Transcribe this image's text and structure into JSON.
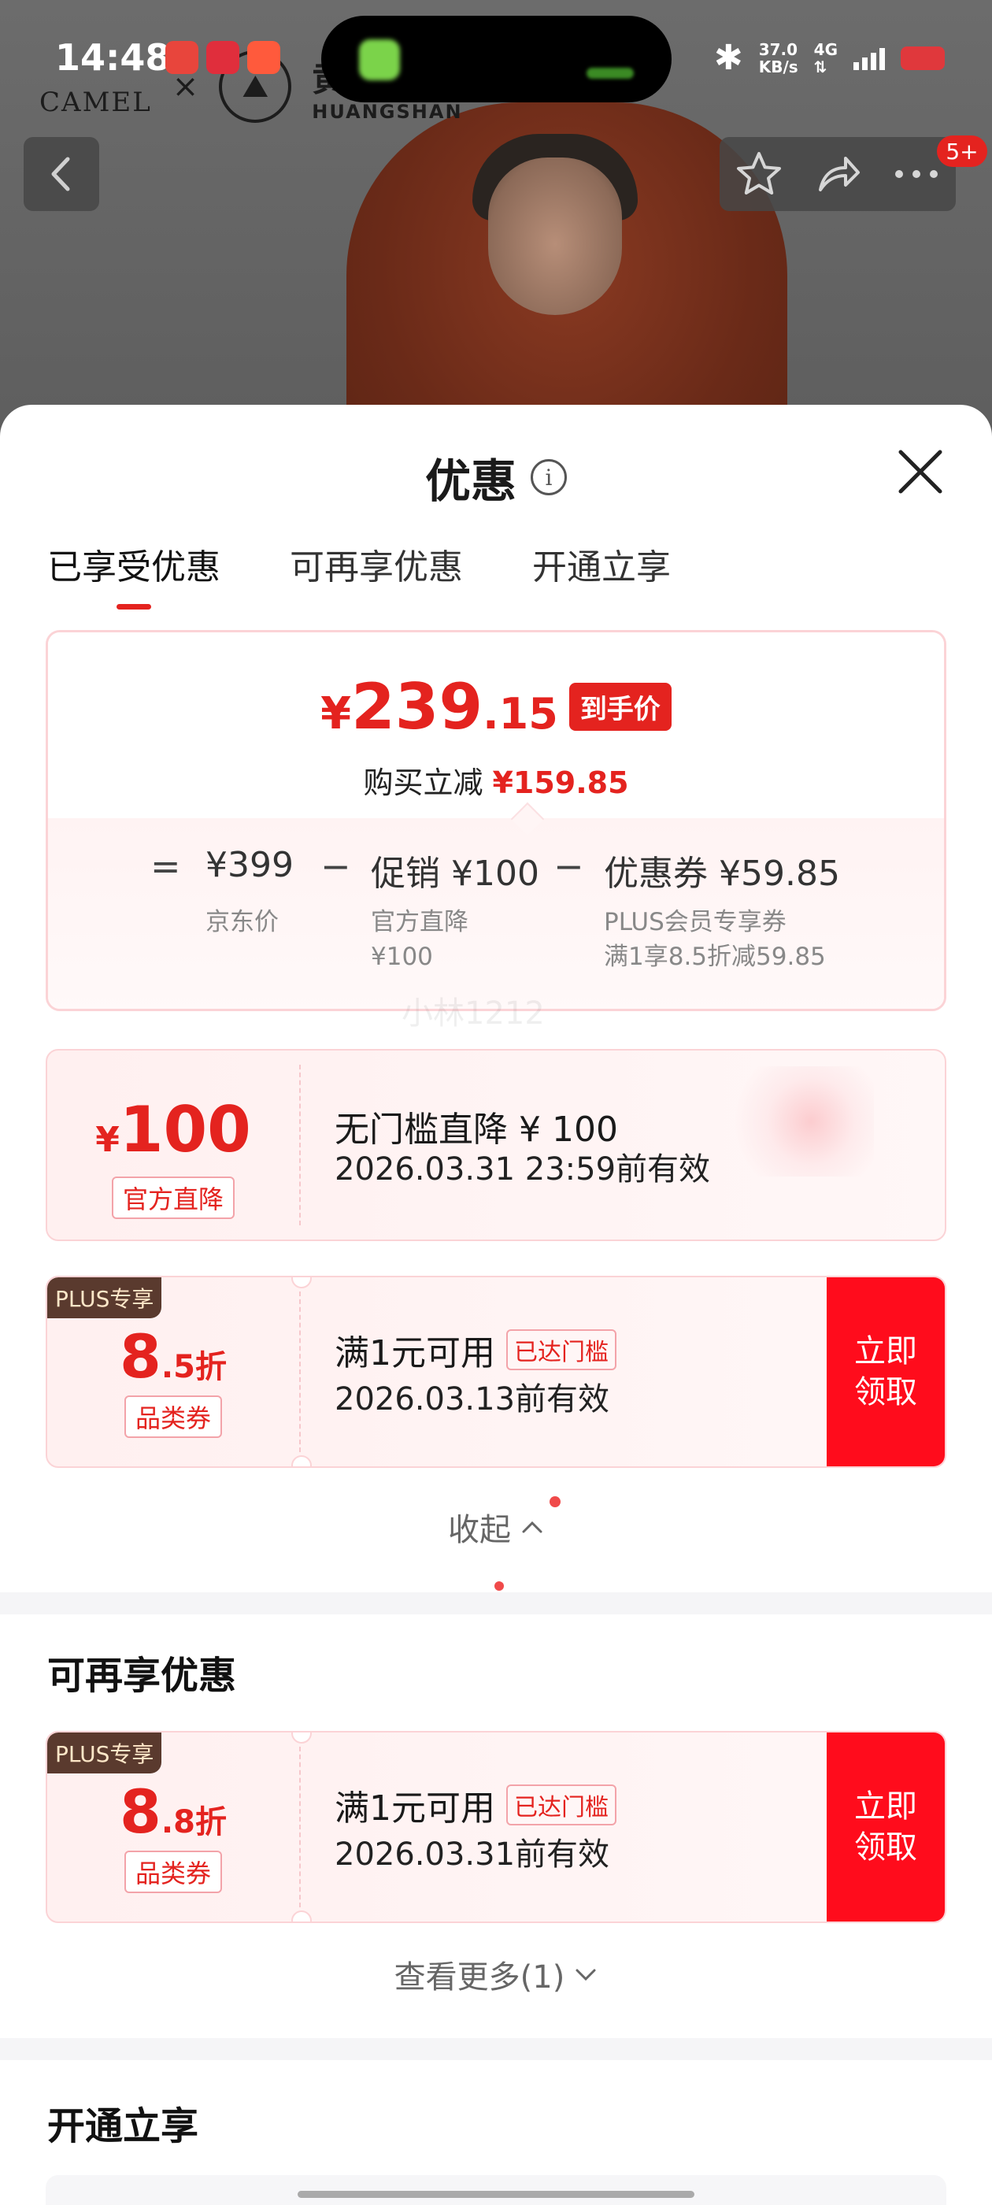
{
  "status_bar": {
    "time": "14:48",
    "speed_value": "37.0",
    "speed_unit": "KB/s",
    "network": "4G"
  },
  "brand": {
    "camel": "CAMEL",
    "times": "×",
    "huangshan_cn": "黄山",
    "huangshan_en": "HUANGSHAN"
  },
  "nav": {
    "cart_badge": "5+"
  },
  "sheet": {
    "title": "优惠",
    "info_icon_glyph": "i",
    "tabs": [
      "已享受优惠",
      "可再享优惠",
      "开通立享"
    ]
  },
  "summary": {
    "currency": "¥",
    "price_int": "239",
    "price_dec": ".15",
    "price_tag": "到手价",
    "save_label": "购买立减",
    "save_amount": "¥159.85",
    "formula": {
      "equals": "=",
      "minus": "−",
      "jd_price": "¥399",
      "jd_price_label": "京东价",
      "promo": "促销 ¥100",
      "promo_label_1": "官方直降",
      "promo_label_2": "¥100",
      "coupon": "优惠券 ¥59.85",
      "coupon_label_1": "PLUS会员专享券",
      "coupon_label_2": "满1享8.5折减59.85"
    }
  },
  "watermark": "小林1212",
  "coupons_enjoyed": [
    {
      "currency": "¥",
      "amount": "100",
      "type_tag": "官方直降",
      "title": "无门槛直降 ¥ 100",
      "valid": "2026.03.31 23:59前有效"
    },
    {
      "plus_tag": "PLUS专享",
      "amount_int": "8",
      "amount_suffix": ".5折",
      "type_tag": "品类券",
      "title": "满1元可用",
      "reached": "已达门槛",
      "valid": "2026.03.13前有效",
      "claim_1": "立即",
      "claim_2": "领取"
    }
  ],
  "collapse_label": "收起",
  "more_section": {
    "title": "可再享优惠",
    "coupon": {
      "plus_tag": "PLUS专享",
      "amount_int": "8",
      "amount_suffix": ".8折",
      "type_tag": "品类券",
      "title": "满1元可用",
      "reached": "已达门槛",
      "valid": "2026.03.31前有效",
      "claim_1": "立即",
      "claim_2": "领取"
    },
    "more_label": "查看更多(1)"
  },
  "open_section": {
    "title": "开通立享"
  },
  "colors": {
    "accent_red": "#e4231f",
    "claim_red": "#ff0c1c",
    "plus_brown": "#5a3a2e"
  }
}
